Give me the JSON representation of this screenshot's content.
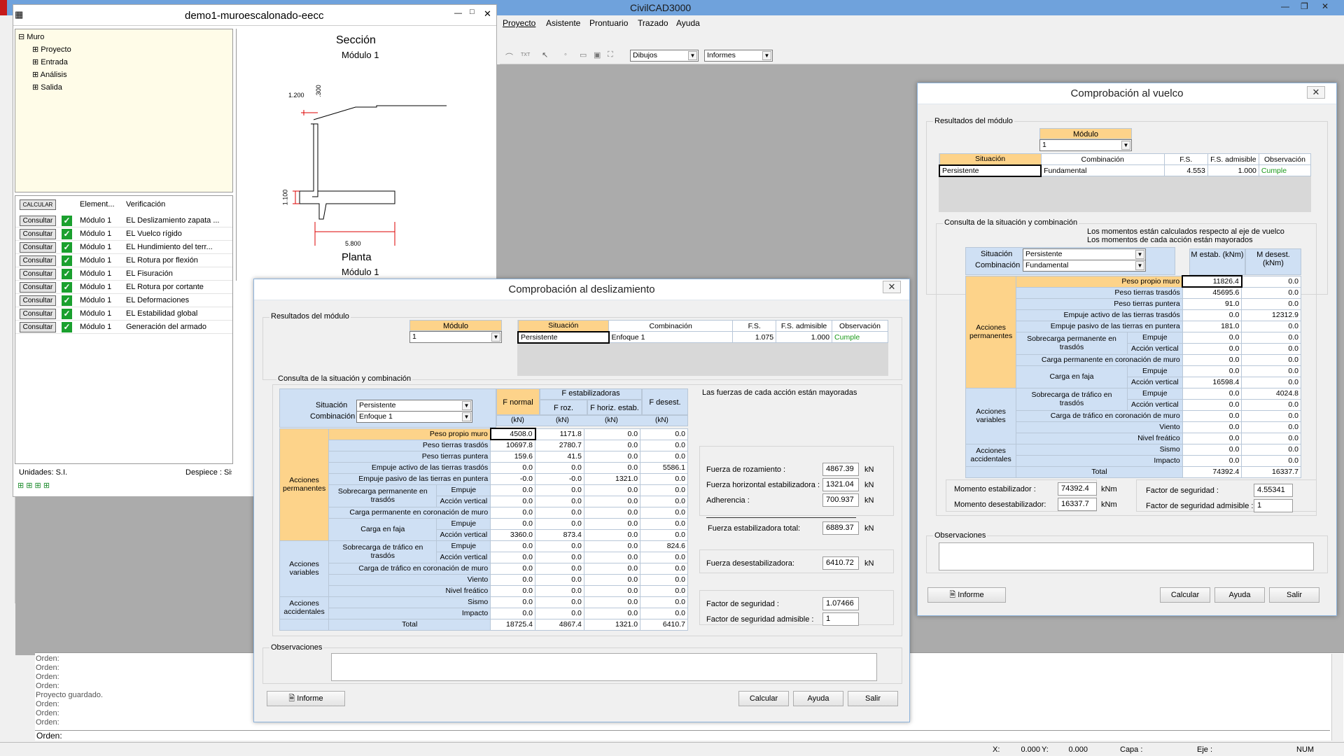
{
  "app": {
    "title": "CivilCAD3000",
    "menu": [
      "Proyecto",
      "Asistente",
      "Prontuario",
      "Trazado",
      "Ayuda"
    ],
    "combo_dibujos": "Dibujos",
    "combo_informes": "Informes",
    "tb_label": "TXT"
  },
  "doc": {
    "title": "demo1-muroescalonado-eecc",
    "tree": {
      "root": "Muro",
      "children": [
        "Proyecto",
        "Entrada",
        "Análisis",
        "Salida"
      ]
    },
    "verif": {
      "calc_label": "CALCULAR",
      "col_element": "Element...",
      "col_verif": "Verificación",
      "consult": "Consultar",
      "rows": [
        {
          "element": "Módulo 1",
          "verif": "EL Deslizamiento zapata ..."
        },
        {
          "element": "Módulo 1",
          "verif": "EL Vuelco rígido"
        },
        {
          "element": "Módulo 1",
          "verif": "EL Hundimiento del terr..."
        },
        {
          "element": "Módulo 1",
          "verif": "EL Rotura por flexión"
        },
        {
          "element": "Módulo 1",
          "verif": "EL Fisuración"
        },
        {
          "element": "Módulo 1",
          "verif": "EL Rotura por cortante"
        },
        {
          "element": "Módulo 1",
          "verif": "EL Deformaciones"
        },
        {
          "element": "Módulo 1",
          "verif": "EL Estabilidad global"
        },
        {
          "element": "Módulo 1",
          "verif": "Generación del armado"
        }
      ]
    },
    "units": "Unidades: S.I.",
    "despiece": "Despiece : Sistema",
    "drawing": {
      "seccion": "Sección",
      "modulo": "Módulo  1",
      "dim_top": "1.200",
      "dim_small": ".300",
      "dim_left": "1.100",
      "dim_bottom": "5.800",
      "planta": "Planta",
      "modulo2": "Módulo  1"
    }
  },
  "command": {
    "lines": [
      "Orden:",
      "Orden:",
      "Orden:",
      "Orden:",
      "Proyecto guardado.",
      "Orden:",
      "Orden:",
      "Orden:"
    ],
    "prompt": "Orden:"
  },
  "status": {
    "x_label": "X:",
    "x": "0.000",
    "y_label": "Y:",
    "y": "0.000",
    "capa": "Capa :",
    "eje": "Eje :",
    "num": "NUM"
  },
  "desl": {
    "title": "Comprobación al deslizamiento",
    "close": "✕",
    "results_label": "Resultados del módulo",
    "modulo_label": "Módulo",
    "modulo_val": "1",
    "res_cols": [
      "Situación",
      "Combinación",
      "F.S.",
      "F.S. admisible",
      "Observación"
    ],
    "res_row": [
      "Persistente",
      "Enfoque 1",
      "1.075",
      "1.000",
      "Cumple"
    ],
    "consulta_label": "Consulta de la situación y combinación",
    "sit_label": "Situación",
    "sit_val": "Persistente",
    "comb_label": "Combinación",
    "comb_val": "Enfoque 1",
    "col_fnormal": "F normal",
    "col_festab": "F estabilizadoras",
    "col_froz": "F roz.",
    "col_fhoriz": "F horiz. estab.",
    "col_fdesest": "F desest.",
    "unit": "(kN)",
    "cat_perm": "Acciones permanentes",
    "cat_var": "Acciones variables",
    "cat_acc": "Acciones accidentales",
    "rows": [
      {
        "label": "Peso propio muro",
        "v": [
          "4508.0",
          "1171.8",
          "0.0",
          "0.0"
        ]
      },
      {
        "label": "Peso tierras trasdós",
        "v": [
          "10697.8",
          "2780.7",
          "0.0",
          "0.0"
        ]
      },
      {
        "label": "Peso tierras puntera",
        "v": [
          "159.6",
          "41.5",
          "0.0",
          "0.0"
        ]
      },
      {
        "label": "Empuje activo de las tierras trasdós",
        "v": [
          "0.0",
          "0.0",
          "0.0",
          "5586.1"
        ]
      },
      {
        "label": "Empuje pasivo de las tierras en puntera",
        "v": [
          "-0.0",
          "-0.0",
          "1321.0",
          "0.0"
        ]
      },
      {
        "label": "Sobrecarga permanente en trasdós",
        "sub": "Empuje",
        "v": [
          "0.0",
          "0.0",
          "0.0",
          "0.0"
        ]
      },
      {
        "label": "",
        "sub": "Acción vertical",
        "v": [
          "0.0",
          "0.0",
          "0.0",
          "0.0"
        ]
      },
      {
        "label": "Carga permanente en coronación de muro",
        "v": [
          "0.0",
          "0.0",
          "0.0",
          "0.0"
        ]
      },
      {
        "label": "Carga en faja",
        "sub": "Empuje",
        "v": [
          "0.0",
          "0.0",
          "0.0",
          "0.0"
        ]
      },
      {
        "label": "",
        "sub": "Acción vertical",
        "v": [
          "3360.0",
          "873.4",
          "0.0",
          "0.0"
        ]
      },
      {
        "label": "Sobrecarga de tráfico en trasdós",
        "sub": "Empuje",
        "v": [
          "0.0",
          "0.0",
          "0.0",
          "824.6"
        ]
      },
      {
        "label": "",
        "sub": "Acción vertical",
        "v": [
          "0.0",
          "0.0",
          "0.0",
          "0.0"
        ]
      },
      {
        "label": "Carga de tráfico en coronación de muro",
        "v": [
          "0.0",
          "0.0",
          "0.0",
          "0.0"
        ]
      },
      {
        "label": "Viento",
        "v": [
          "0.0",
          "0.0",
          "0.0",
          "0.0"
        ]
      },
      {
        "label": "Nivel freático",
        "v": [
          "0.0",
          "0.0",
          "0.0",
          "0.0"
        ]
      },
      {
        "label": "Sismo",
        "v": [
          "0.0",
          "0.0",
          "0.0",
          "0.0"
        ]
      },
      {
        "label": "Impacto",
        "v": [
          "0.0",
          "0.0",
          "0.0",
          "0.0"
        ]
      },
      {
        "label": "Total",
        "v": [
          "18725.4",
          "4867.4",
          "1321.0",
          "6410.7"
        ]
      }
    ],
    "note": "Las fuerzas de cada acción están mayoradas",
    "f_roz_label": "Fuerza de rozamiento :",
    "f_roz": "4867.39",
    "f_horiz_label": "Fuerza horizontal estabilizadora :",
    "f_horiz": "1321.04",
    "adh_label": "Adherencia :",
    "adh": "700.937",
    "f_tot_label": "Fuerza estabilizadora total:",
    "f_tot": "6889.37",
    "f_des_label": "Fuerza desestabilizadora:",
    "f_des": "6410.72",
    "kn": "kN",
    "fs_label": "Factor de seguridad :",
    "fs": "1.07466",
    "fsa_label": "Factor de seguridad admisible :",
    "fsa": "1",
    "obs_label": "Observaciones",
    "informe": "Informe",
    "calcular": "Calcular",
    "ayuda": "Ayuda",
    "salir": "Salir"
  },
  "vuelco": {
    "title": "Comprobación al vuelco",
    "close": "✕",
    "results_label": "Resultados del módulo",
    "modulo_label": "Módulo",
    "modulo_val": "1",
    "res_cols": [
      "Situación",
      "Combinación",
      "F.S.",
      "F.S. admisible",
      "Observación"
    ],
    "res_row": [
      "Persistente",
      "Fundamental",
      "4.553",
      "1.000",
      "Cumple"
    ],
    "consulta_label": "Consulta de la situación y combinación",
    "note1": "Los momentos están calculados respecto al eje de vuelco",
    "note2": "Los momentos de cada acción están mayorados",
    "sit_label": "Situación",
    "sit_val": "Persistente",
    "comb_label": "Combinación",
    "comb_val": "Fundamental",
    "col_mestab": "M estab.  (kNm)",
    "col_mdesest": "M desest. (kNm)",
    "cat_perm": "Acciones permanentes",
    "cat_var": "Acciones variables",
    "cat_acc": "Acciones accidentales",
    "rows": [
      {
        "label": "Peso propio muro",
        "v": [
          "11826.4",
          "0.0"
        ]
      },
      {
        "label": "Peso tierras trasdós",
        "v": [
          "45695.6",
          "0.0"
        ]
      },
      {
        "label": "Peso tierras puntera",
        "v": [
          "91.0",
          "0.0"
        ]
      },
      {
        "label": "Empuje activo de las tierras trasdós",
        "v": [
          "0.0",
          "12312.9"
        ]
      },
      {
        "label": "Empuje pasivo de las tierras en puntera",
        "v": [
          "181.0",
          "0.0"
        ]
      },
      {
        "label": "Sobrecarga permanente en trasdós",
        "sub": "Empuje",
        "v": [
          "0.0",
          "0.0"
        ]
      },
      {
        "label": "",
        "sub": "Acción vertical",
        "v": [
          "0.0",
          "0.0"
        ]
      },
      {
        "label": "Carga permanente en coronación de muro",
        "v": [
          "0.0",
          "0.0"
        ]
      },
      {
        "label": "Carga en faja",
        "sub": "Empuje",
        "v": [
          "0.0",
          "0.0"
        ]
      },
      {
        "label": "",
        "sub": "Acción vertical",
        "v": [
          "16598.4",
          "0.0"
        ]
      },
      {
        "label": "Sobrecarga de tráfico en trasdós",
        "sub": "Empuje",
        "v": [
          "0.0",
          "4024.8"
        ]
      },
      {
        "label": "",
        "sub": "Acción vertical",
        "v": [
          "0.0",
          "0.0"
        ]
      },
      {
        "label": "Carga de tráfico en coronación de muro",
        "v": [
          "0.0",
          "0.0"
        ]
      },
      {
        "label": "Viento",
        "v": [
          "0.0",
          "0.0"
        ]
      },
      {
        "label": "Nivel freático",
        "v": [
          "0.0",
          "0.0"
        ]
      },
      {
        "label": "Sismo",
        "v": [
          "0.0",
          "0.0"
        ]
      },
      {
        "label": "Impacto",
        "v": [
          "0.0",
          "0.0"
        ]
      },
      {
        "label": "Total",
        "v": [
          "74392.4",
          "16337.7"
        ]
      }
    ],
    "mom_est_label": "Momento estabilizador :",
    "mom_est": "74392.4",
    "mom_des_label": "Momento desestabilizador:",
    "mom_des": "16337.7",
    "knm": "kNm",
    "fs_label": "Factor de seguridad :",
    "fs": "4.55341",
    "fsa_label": "Factor de seguridad admisible :",
    "fsa": "1",
    "obs_label": "Observaciones",
    "informe": "Informe",
    "calcular": "Calcular",
    "ayuda": "Ayuda",
    "salir": "Salir"
  }
}
